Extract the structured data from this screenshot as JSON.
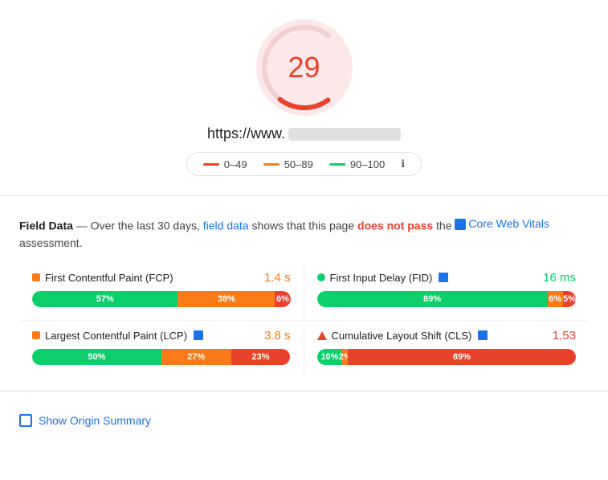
{
  "score": {
    "value": "29",
    "color": "#e8412c",
    "bg_color": "#fce8e8"
  },
  "url": {
    "prefix": "https://www.",
    "redacted": true
  },
  "legend": {
    "items": [
      {
        "label": "0–49",
        "color": "#e8412c"
      },
      {
        "label": "50–89",
        "color": "#fa7b17"
      },
      {
        "label": "90–100",
        "color": "#0cce6b"
      }
    ],
    "info_icon": "ℹ"
  },
  "field_data": {
    "title": "Field Data",
    "description_prefix": " — Over the last 30 days, ",
    "field_data_link": "field data",
    "description_middle": " shows that this page ",
    "fail_text": "does not pass",
    "description_suffix": " the ",
    "cwv_link": "Core Web Vitals",
    "description_end": " assessment."
  },
  "metrics": [
    {
      "id": "fcp",
      "icon_type": "orange-square",
      "title": "First Contentful Paint (FCP)",
      "has_flag": false,
      "value": "1.4 s",
      "value_color": "orange",
      "bars": [
        {
          "pct": 57,
          "label": "57%",
          "color": "green"
        },
        {
          "pct": 38,
          "label": "38%",
          "color": "orange"
        },
        {
          "pct": 6,
          "label": "6%",
          "color": "red"
        }
      ]
    },
    {
      "id": "fid",
      "icon_type": "green-circle",
      "title": "First Input Delay (FID)",
      "has_flag": true,
      "value": "16 ms",
      "value_color": "green",
      "bars": [
        {
          "pct": 89,
          "label": "89%",
          "color": "green"
        },
        {
          "pct": 6,
          "label": "6%",
          "color": "orange"
        },
        {
          "pct": 5,
          "label": "5%",
          "color": "red"
        }
      ]
    },
    {
      "id": "lcp",
      "icon_type": "orange-square",
      "title": "Largest Contentful Paint (LCP)",
      "has_flag": true,
      "value": "3.8 s",
      "value_color": "orange",
      "bars": [
        {
          "pct": 50,
          "label": "50%",
          "color": "green"
        },
        {
          "pct": 27,
          "label": "27%",
          "color": "orange"
        },
        {
          "pct": 23,
          "label": "23%",
          "color": "red"
        }
      ]
    },
    {
      "id": "cls",
      "icon_type": "red-triangle",
      "title": "Cumulative Layout Shift (CLS)",
      "has_flag": true,
      "value": "1.53",
      "value_color": "red",
      "bars": [
        {
          "pct": 10,
          "label": "10%",
          "color": "green"
        },
        {
          "pct": 2,
          "label": "2%",
          "color": "orange"
        },
        {
          "pct": 89,
          "label": "89%",
          "color": "red"
        }
      ]
    }
  ],
  "footer": {
    "show_origin_label": "Show Origin Summary"
  }
}
